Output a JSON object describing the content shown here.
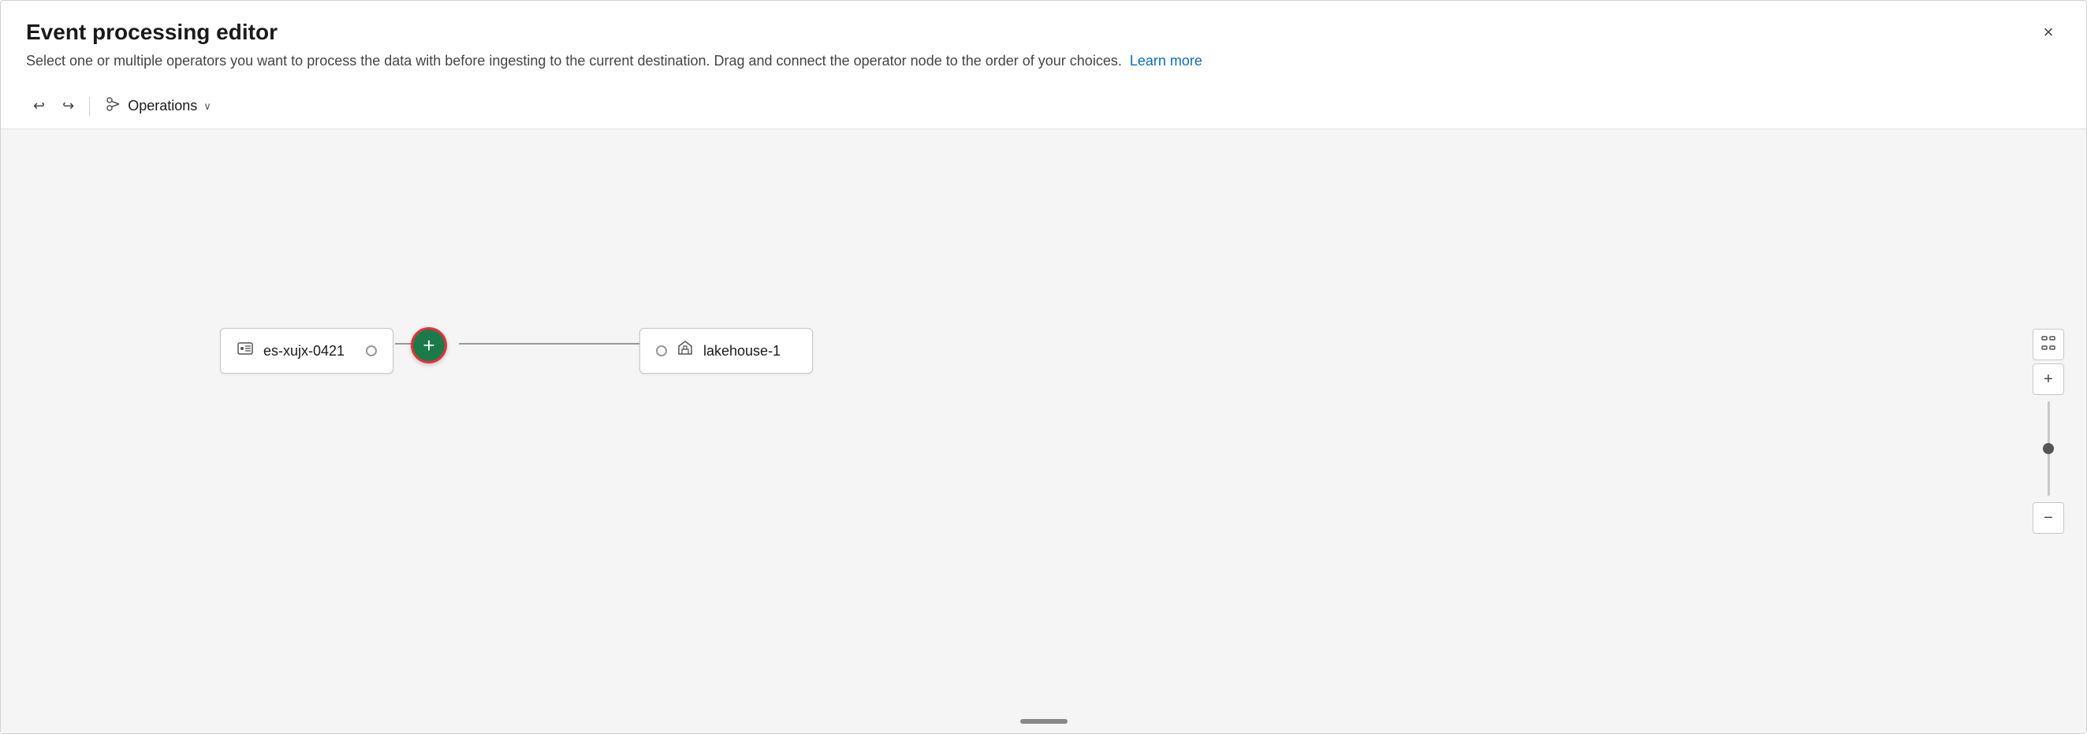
{
  "dialog": {
    "title": "Event processing editor",
    "subtitle": "Select one or multiple operators you want to process the data with before ingesting to the current destination. Drag and connect the operator node to the order of your choices.",
    "learn_more_label": "Learn more",
    "close_label": "×"
  },
  "toolbar": {
    "undo_label": "↩",
    "redo_label": "↪",
    "operations_label": "Operations",
    "chevron_label": "⌄"
  },
  "canvas": {
    "source_node": {
      "label": "es-xujx-0421"
    },
    "destination_node": {
      "label": "lakehouse-1"
    },
    "add_button_label": "+"
  },
  "zoom": {
    "fit_label": "⤢",
    "zoom_in_label": "+",
    "zoom_out_label": "−"
  }
}
